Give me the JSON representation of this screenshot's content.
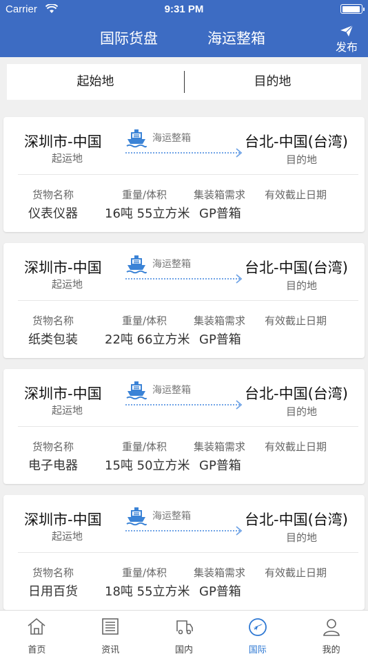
{
  "status_bar": {
    "carrier": "Carrier",
    "time": "9:31 PM"
  },
  "header": {
    "tabs": [
      {
        "label": "国际货盘"
      },
      {
        "label": "海运整箱"
      }
    ],
    "publish_label": "发布"
  },
  "filter": {
    "origin_label": "起始地",
    "destination_label": "目的地"
  },
  "field_labels": {
    "cargo": "货物名称",
    "weight_volume": "重量/体积",
    "container": "集装箱需求",
    "valid_until": "有效截止日期"
  },
  "cards": [
    {
      "origin": "深圳市-中国",
      "origin_sub": "起运地",
      "mode": "海运整箱",
      "destination": "台北-中国(台湾)",
      "destination_sub": "目的地",
      "cargo": "仪表仪器",
      "weight_volume": "16吨 55立方米",
      "container": "GP普箱"
    },
    {
      "origin": "深圳市-中国",
      "origin_sub": "起运地",
      "mode": "海运整箱",
      "destination": "台北-中国(台湾)",
      "destination_sub": "目的地",
      "cargo": "纸类包装",
      "weight_volume": "22吨 66立方米",
      "container": "GP普箱"
    },
    {
      "origin": "深圳市-中国",
      "origin_sub": "起运地",
      "mode": "海运整箱",
      "destination": "台北-中国(台湾)",
      "destination_sub": "目的地",
      "cargo": "电子电器",
      "weight_volume": "15吨 50立方米",
      "container": "GP普箱"
    },
    {
      "origin": "深圳市-中国",
      "origin_sub": "起运地",
      "mode": "海运整箱",
      "destination": "台北-中国(台湾)",
      "destination_sub": "目的地",
      "cargo": "日用百货",
      "weight_volume": "18吨 55立方米",
      "container": "GP普箱"
    }
  ],
  "bottom_nav": [
    {
      "label": "首页",
      "icon": "home-icon"
    },
    {
      "label": "资讯",
      "icon": "news-icon"
    },
    {
      "label": "国内",
      "icon": "truck-icon"
    },
    {
      "label": "国际",
      "icon": "airplane-icon",
      "active": true
    },
    {
      "label": "我的",
      "icon": "user-icon"
    }
  ],
  "colors": {
    "header_bg": "#3d6cc3",
    "accent": "#2e78d3",
    "page_bg": "#f0f0f0"
  }
}
